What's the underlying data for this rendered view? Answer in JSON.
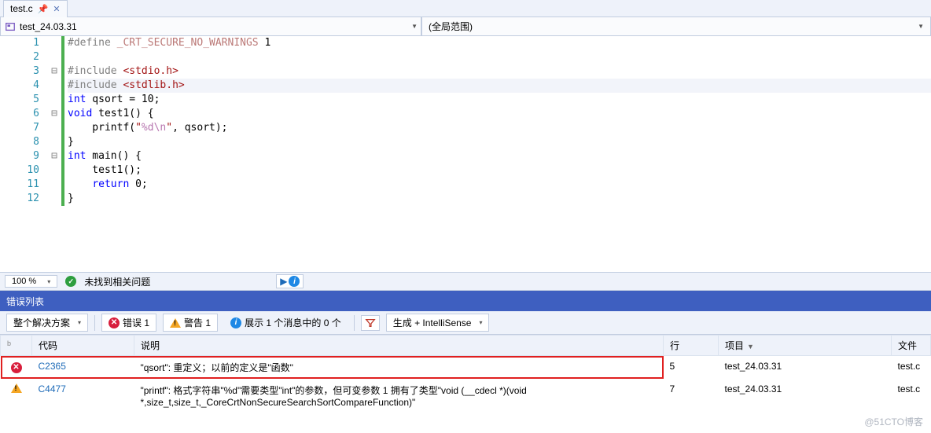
{
  "tab": {
    "filename": "test.c"
  },
  "navbar": {
    "left_label": "test_24.03.31",
    "right_label": "(全局范围)"
  },
  "code": {
    "lines": [
      {
        "n": 1,
        "fold": "",
        "html": "<span class='pp'>#define</span> <span class='def'>_CRT_SECURE_NO_WARNINGS</span> 1"
      },
      {
        "n": 2,
        "fold": "",
        "html": ""
      },
      {
        "n": 3,
        "fold": "⊟",
        "html": "<span class='pp'>#include</span> <span class='hdr'>&lt;stdio.h&gt;</span>"
      },
      {
        "n": 4,
        "fold": "",
        "html": "<span class='pp'>#include</span> <span class='hdr'>&lt;stdlib.h&gt;</span>",
        "highlight": true
      },
      {
        "n": 5,
        "fold": "",
        "html": "<span class='kw'>int</span> qsort = 10;"
      },
      {
        "n": 6,
        "fold": "⊟",
        "html": "<span class='kw'>void</span> test1() {"
      },
      {
        "n": 7,
        "fold": "",
        "html": "    printf(<span class='str'>\"</span><span class='esc'>%d\\n</span><span class='str'>\"</span>, qsort);"
      },
      {
        "n": 8,
        "fold": "",
        "html": "}"
      },
      {
        "n": 9,
        "fold": "⊟",
        "html": "<span class='kw'>int</span> main() {"
      },
      {
        "n": 10,
        "fold": "",
        "html": "    test1();"
      },
      {
        "n": 11,
        "fold": "",
        "html": "    <span class='kw'>return</span> 0;"
      },
      {
        "n": 12,
        "fold": "",
        "html": "}"
      }
    ]
  },
  "status": {
    "zoom": "100 %",
    "issues_text": "未找到相关问题"
  },
  "error_panel": {
    "title": "错误列表",
    "scope": "整个解决方案",
    "errors_label": "错误 1",
    "warnings_label": "警告 1",
    "messages_label": "展示 1 个消息中的 0 个",
    "build_label": "生成 + IntelliSense"
  },
  "error_table": {
    "headers": {
      "code": "代码",
      "desc": "说明",
      "line": "行",
      "project": "项目",
      "file": "文件"
    },
    "rows": [
      {
        "icon": "error",
        "code": "C2365",
        "desc": "\"qsort\": 重定义；以前的定义是\"函数\"",
        "line": "5",
        "project": "test_24.03.31",
        "file": "test.c",
        "highlight": true
      },
      {
        "icon": "warning",
        "code": "C4477",
        "desc": "\"printf\": 格式字符串\"%d\"需要类型\"int\"的参数，但可变参数 1 拥有了类型\"void (__cdecl *)(void *,size_t,size_t,_CoreCrtNonSecureSearchSortCompareFunction)\"",
        "line": "7",
        "project": "test_24.03.31",
        "file": "test.c",
        "highlight": false
      }
    ]
  },
  "watermark": "@51CTO博客"
}
